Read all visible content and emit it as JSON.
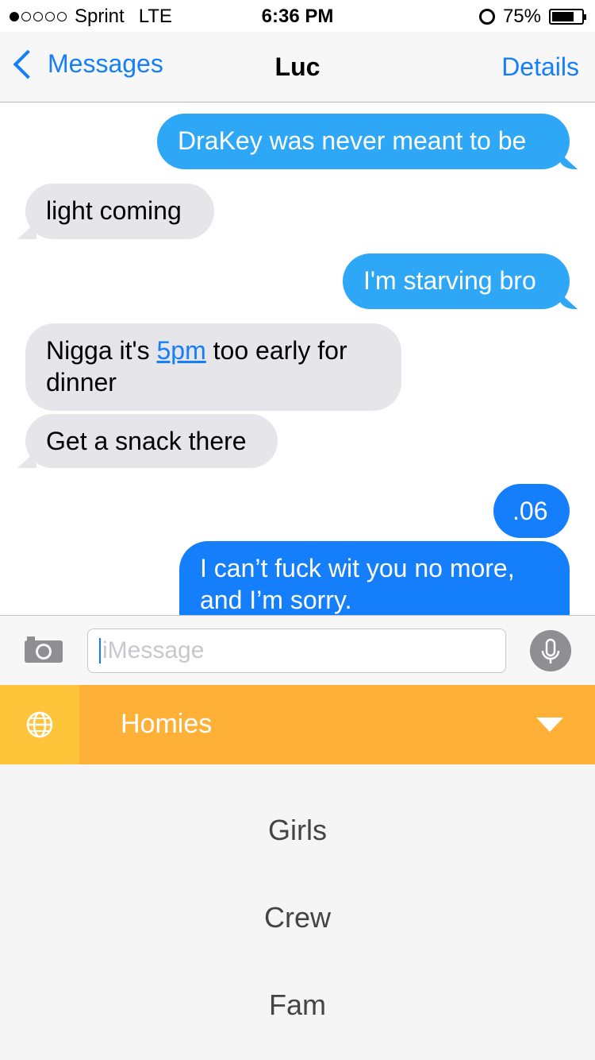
{
  "status_bar": {
    "carrier": "Sprint",
    "network": "LTE",
    "signal_bars": 1,
    "time": "6:36 PM",
    "battery": "75%",
    "battery_level": 0.75
  },
  "nav": {
    "back_label": "Messages",
    "title": "Luc",
    "details_label": "Details"
  },
  "messages": [
    {
      "from": "me",
      "text": "DraKey was never meant to be"
    },
    {
      "from": "them",
      "text": "light coming"
    },
    {
      "from": "me",
      "text": "I'm starving bro"
    },
    {
      "from": "them",
      "text_before": "Nigga it's ",
      "link": "5pm",
      "text_after": " too early for",
      "text_line2": "dinner"
    },
    {
      "from": "them",
      "text": "Get a snack there"
    },
    {
      "from": "me",
      "text": ".06"
    },
    {
      "from": "me",
      "text": "I can’t fuck wit you no more,",
      "text_line2": "and I’m sorry."
    }
  ],
  "input": {
    "placeholder": "iMessage"
  },
  "keyboard": {
    "selected_group": "Homies",
    "options": [
      "Girls",
      "Crew",
      "Fam"
    ],
    "accent": "#feb037"
  },
  "colors": {
    "blue": "#157efb",
    "sms_bubble": "#2ea8f6",
    "received_bubble": "#e5e5ea"
  }
}
